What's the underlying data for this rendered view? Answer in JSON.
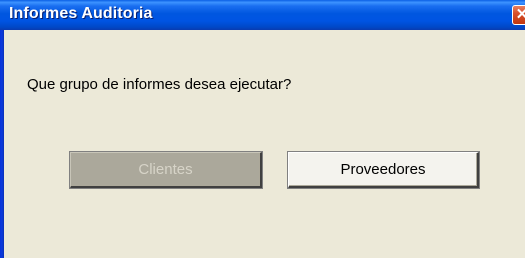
{
  "window": {
    "title": "Informes Auditoria",
    "close_glyph": "✕"
  },
  "dialog": {
    "prompt": "Que grupo de informes desea ejecutar?",
    "buttons": {
      "clientes": "Clientes",
      "proveedores": "Proveedores"
    }
  },
  "colors": {
    "titlebar": "#0054e3",
    "face": "#ece9d8",
    "close": "#c2380f"
  },
  "icons": {
    "close": "close-icon"
  }
}
